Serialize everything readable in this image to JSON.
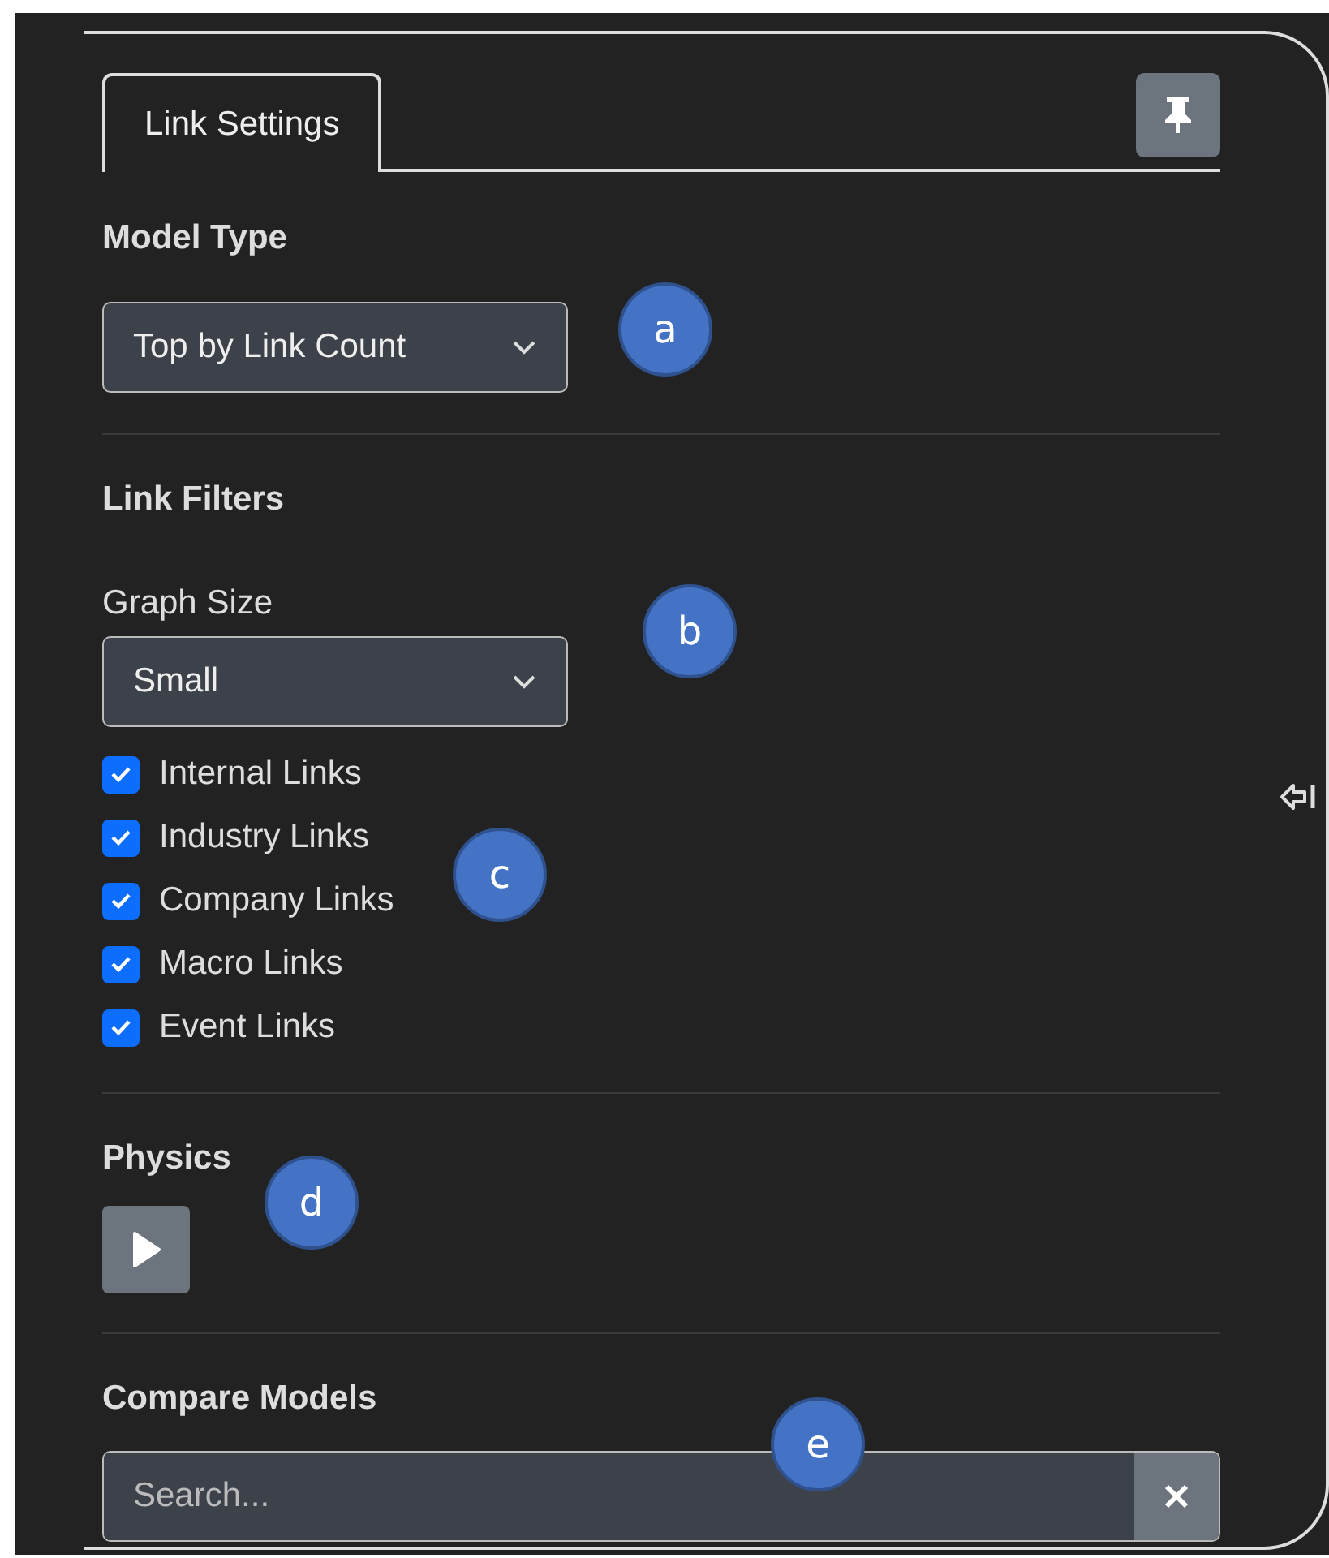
{
  "tabs": [
    {
      "label": "Link Settings",
      "selected": true
    }
  ],
  "model_type": {
    "label": "Model Type",
    "value": "Top by Link Count"
  },
  "link_filters": {
    "heading": "Link Filters",
    "graph_size": {
      "label": "Graph Size",
      "value": "Small"
    },
    "checkboxes": [
      {
        "label": "Internal Links",
        "checked": true
      },
      {
        "label": "Industry Links",
        "checked": true
      },
      {
        "label": "Company Links",
        "checked": true
      },
      {
        "label": "Macro Links",
        "checked": true
      },
      {
        "label": "Event Links",
        "checked": true
      }
    ]
  },
  "physics": {
    "label": "Physics"
  },
  "compare_models": {
    "label": "Compare Models",
    "placeholder": "Search..."
  },
  "callouts": [
    {
      "label": "a"
    },
    {
      "label": "b"
    },
    {
      "label": "c"
    },
    {
      "label": "d"
    },
    {
      "label": "e"
    }
  ]
}
